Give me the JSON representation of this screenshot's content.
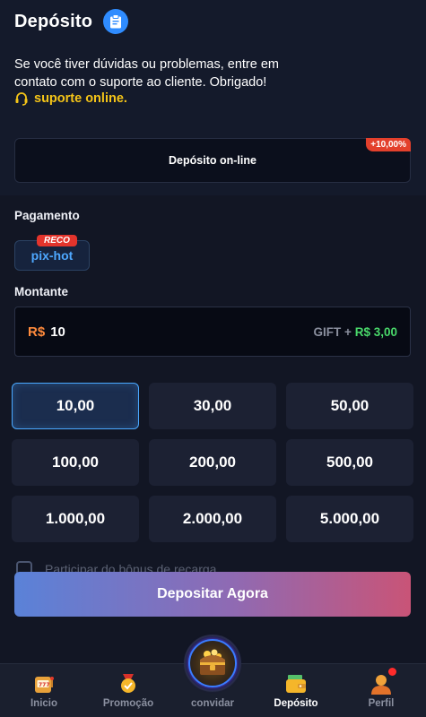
{
  "header": {
    "title": "Depósito"
  },
  "info": {
    "line1": "Se você tiver dúvidas ou problemas, entre em",
    "line2": "contato com o suporte ao cliente. Obrigado!",
    "support_link": "suporte online."
  },
  "method_tab": {
    "label": "Depósito on-line",
    "bonus": "+10,00%"
  },
  "payment": {
    "label": "Pagamento",
    "option": "pix-hot",
    "badge": "RECO"
  },
  "amount": {
    "label": "Montante",
    "currency": "R$",
    "value": "10",
    "gift_label": "GIFT +",
    "gift_value": "R$ 3,00"
  },
  "options": [
    "10,00",
    "30,00",
    "50,00",
    "100,00",
    "200,00",
    "500,00",
    "1.000,00",
    "2.000,00",
    "5.000,00"
  ],
  "selected_option": "10,00",
  "bonus_checkbox": {
    "label": "Participar do bônus de recarga",
    "checked": false
  },
  "deposit_button": "Depositar Agora",
  "nav": {
    "home": "Inicio",
    "promo": "Promoção",
    "invite": "convidar",
    "deposit": "Depósito",
    "profile": "Perfil",
    "active": "deposit"
  },
  "colors": {
    "background": "#121624",
    "accent_blue": "#4aa8ff",
    "support_yellow": "#f5c518",
    "bonus_red": "#e3402c",
    "gift_green": "#49d86a",
    "currency_orange": "#ff8a3c"
  }
}
